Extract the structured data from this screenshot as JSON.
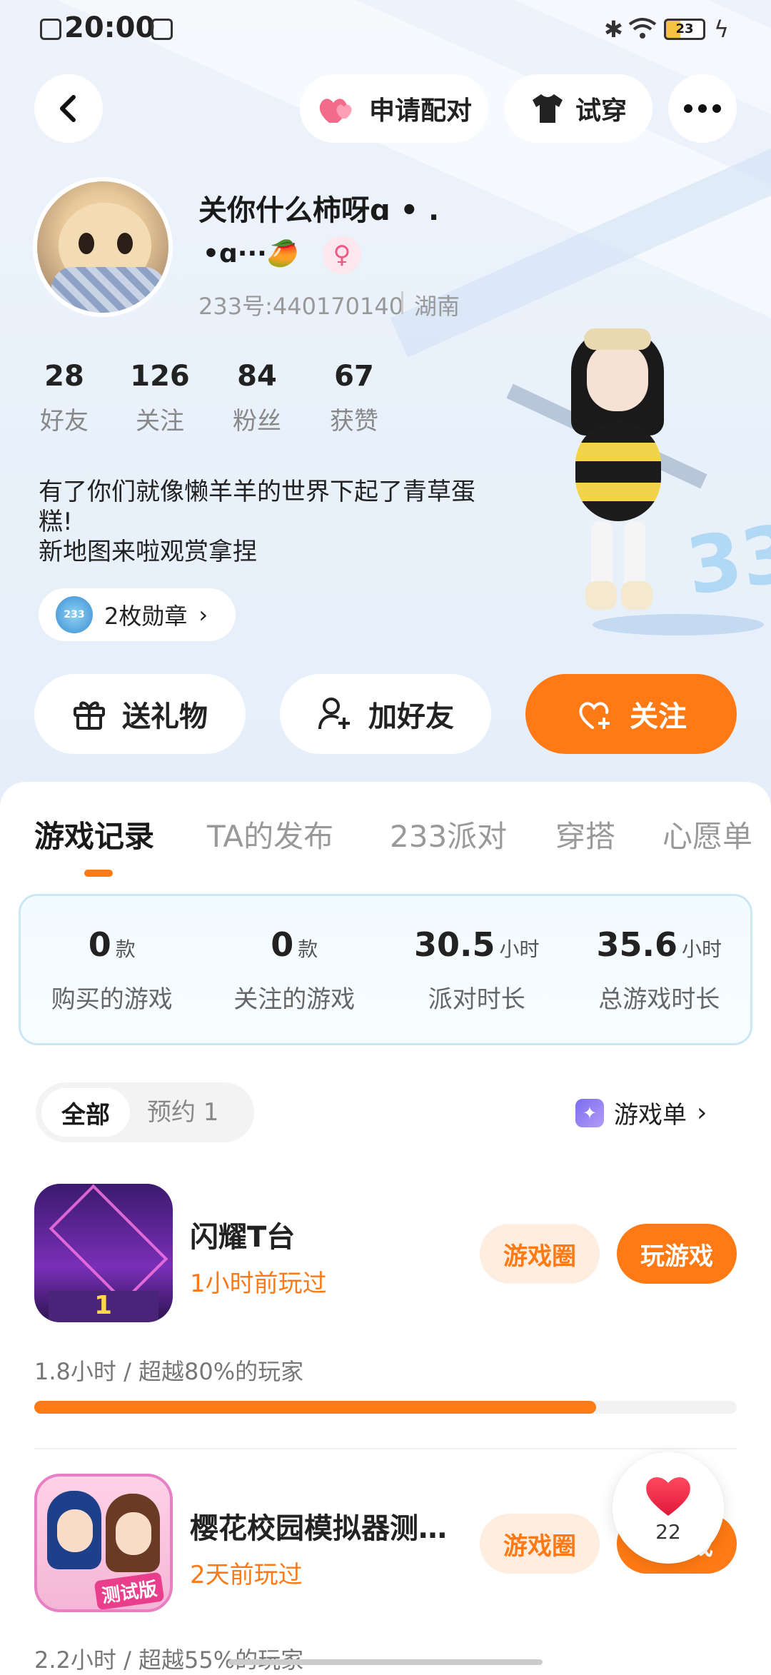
{
  "status_bar": {
    "time": "20:00",
    "battery": "23"
  },
  "header": {
    "match_label": "申请配对",
    "tryon_label": "试穿"
  },
  "profile": {
    "name": "关你什么柿呀ɑ • .",
    "name_line2": "•ɑ···🥭",
    "id_text": "233号:440170140",
    "location": "湖南",
    "stats": [
      {
        "value": "28",
        "label": "好友"
      },
      {
        "value": "126",
        "label": "关注"
      },
      {
        "value": "84",
        "label": "粉丝"
      },
      {
        "value": "67",
        "label": "获赞"
      }
    ],
    "bio_line1": "有了你们就像懒羊羊的世界下起了青草蛋",
    "bio_line2": "糕!",
    "bio_line3": "新地图来啦观赏拿捏",
    "badge_label": "2枚勋章",
    "badge_tag": "233"
  },
  "actions": {
    "gift_label": "送礼物",
    "add_friend_label": "加好友",
    "follow_label": "关注"
  },
  "tabs": [
    "游戏记录",
    "TA的发布",
    "233派对",
    "穿搭",
    "心愿单"
  ],
  "summary": [
    {
      "value": "0",
      "unit": "款",
      "label": "购买的游戏"
    },
    {
      "value": "0",
      "unit": "款",
      "label": "关注的游戏"
    },
    {
      "value": "30.5",
      "unit": "小时",
      "label": "派对时长"
    },
    {
      "value": "35.6",
      "unit": "小时",
      "label": "总游戏时长"
    }
  ],
  "filter": {
    "all_label": "全部",
    "reserve_label": "预约 1",
    "playlist_label": "游戏单"
  },
  "games": [
    {
      "title": "闪耀T台",
      "last_played": "1小时前玩过",
      "stat": "1.8小时 / 超越80%的玩家",
      "progress": 0.8,
      "circle_label": "游戏圈",
      "play_label": "玩游戏",
      "icon_tag": "1"
    },
    {
      "title": "樱花校园模拟器测…",
      "last_played": "2天前玩过",
      "stat": "2.2小时 / 超越55%的玩家",
      "progress": 0.55,
      "circle_label": "游戏圈",
      "play_label": "玩游戏",
      "icon_tag": "测试版"
    }
  ],
  "float_like": {
    "count": "22"
  },
  "colors": {
    "accent": "#ff7a14",
    "card_border": "#c9e7f4"
  }
}
